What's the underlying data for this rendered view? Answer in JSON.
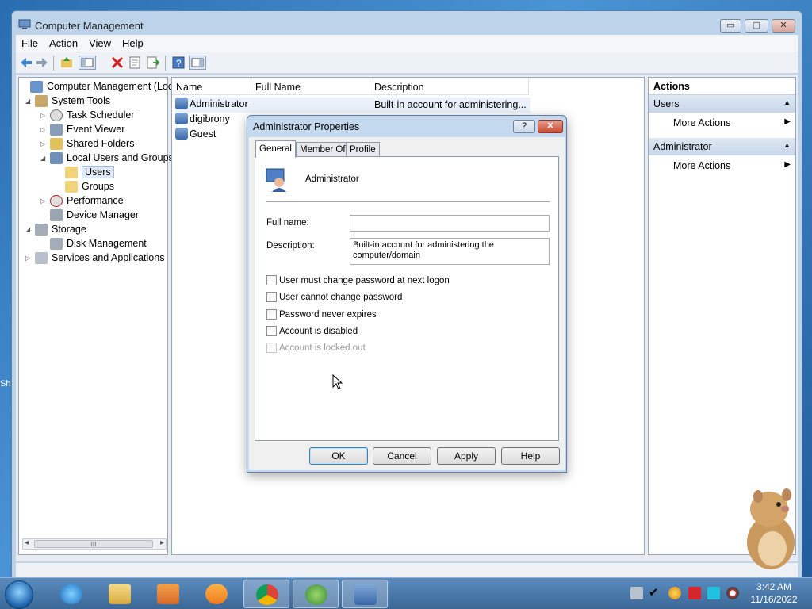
{
  "window": {
    "title": "Computer Management",
    "controls": {
      "minimize": "▭",
      "maximize": "▢",
      "close": "✕"
    }
  },
  "menubar": [
    "File",
    "Action",
    "View",
    "Help"
  ],
  "tree": {
    "items": [
      {
        "label": "Computer Management (Local",
        "expander": "",
        "icon": "computer-management-icon"
      },
      {
        "label": "System Tools",
        "expander": "◢",
        "icon": "tools-icon"
      },
      {
        "label": "Task Scheduler",
        "expander": "▷",
        "icon": "clock-icon"
      },
      {
        "label": "Event Viewer",
        "expander": "▷",
        "icon": "event-viewer-icon"
      },
      {
        "label": "Shared Folders",
        "expander": "▷",
        "icon": "shared-folder-icon"
      },
      {
        "label": "Local Users and Groups",
        "expander": "◢",
        "icon": "users-groups-icon"
      },
      {
        "label": "Users",
        "expander": "",
        "icon": "folder-icon"
      },
      {
        "label": "Groups",
        "expander": "",
        "icon": "folder-icon"
      },
      {
        "label": "Performance",
        "expander": "▷",
        "icon": "performance-icon"
      },
      {
        "label": "Device Manager",
        "expander": "",
        "icon": "device-manager-icon"
      },
      {
        "label": "Storage",
        "expander": "◢",
        "icon": "storage-icon"
      },
      {
        "label": "Disk Management",
        "expander": "",
        "icon": "disk-icon"
      },
      {
        "label": "Services and Applications",
        "expander": "▷",
        "icon": "services-icon"
      }
    ],
    "scroll_thumb": "III",
    "scroll_left": "◂",
    "scroll_right": "▸"
  },
  "list": {
    "columns": [
      "Name",
      "Full Name",
      "Description"
    ],
    "rows": [
      {
        "name": "Administrator",
        "full_name": "",
        "description": "Built-in account for administering..."
      },
      {
        "name": "digibrony",
        "full_name": "",
        "description": ""
      },
      {
        "name": "Guest",
        "full_name": "",
        "description": ""
      }
    ]
  },
  "actions": {
    "header": "Actions",
    "sections": [
      {
        "title": "Users",
        "item": "More Actions"
      },
      {
        "title": "Administrator",
        "item": "More Actions"
      }
    ]
  },
  "dialog": {
    "title": "Administrator Properties",
    "help_glyph": "?",
    "close_glyph": "✕",
    "tabs": [
      "General",
      "Member Of",
      "Profile"
    ],
    "user_name": "Administrator",
    "full_name_label": "Full name:",
    "full_name_value": "",
    "description_label": "Description:",
    "description_line1": "Built-in account for administering the",
    "description_line2": "computer/domain",
    "checkboxes": [
      {
        "label": "User must change password at next logon",
        "checked": false,
        "enabled": true
      },
      {
        "label": "User cannot change password",
        "checked": false,
        "enabled": true
      },
      {
        "label": "Password never expires",
        "checked": false,
        "enabled": true
      },
      {
        "label": "Account is disabled",
        "checked": false,
        "enabled": true
      },
      {
        "label": "Account is locked out",
        "checked": false,
        "enabled": false
      }
    ],
    "buttons": {
      "ok": "OK",
      "cancel": "Cancel",
      "apply": "Apply",
      "help": "Help"
    }
  },
  "taskbar": {
    "clock_time": "3:42 AM",
    "clock_date": "11/16/2022"
  },
  "colors": {
    "titlebar": "#bcd3ea",
    "selection": "#dfe9f7",
    "taskbar": "#4a78a8"
  }
}
